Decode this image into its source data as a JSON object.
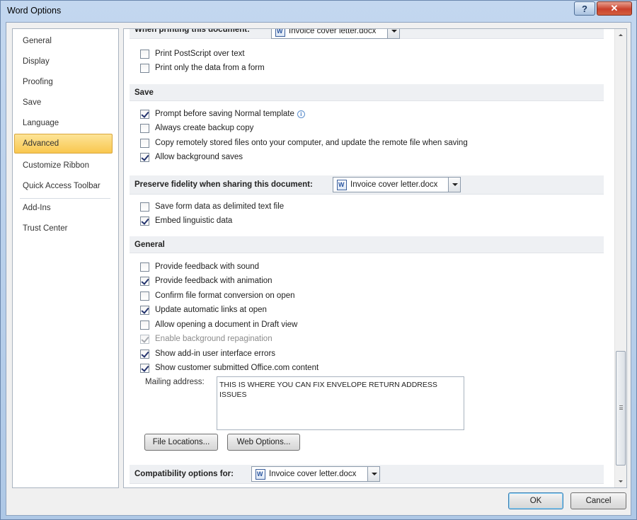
{
  "window": {
    "title": "Word Options",
    "help_glyph": "?",
    "close_glyph": "✕"
  },
  "nav": {
    "items": [
      {
        "label": "General"
      },
      {
        "label": "Display"
      },
      {
        "label": "Proofing"
      },
      {
        "label": "Save"
      },
      {
        "label": "Language"
      },
      {
        "label": "Advanced",
        "selected": true
      },
      {
        "label": "Customize Ribbon"
      },
      {
        "label": "Quick Access Toolbar"
      },
      {
        "label": "Add-Ins"
      },
      {
        "label": "Trust Center"
      }
    ]
  },
  "printing": {
    "header": "When printing this document:",
    "document": "Invoice cover letter.docx",
    "options": [
      {
        "label": "Print PostScript over text",
        "checked": false
      },
      {
        "label": "Print only the data from a form",
        "checked": false
      }
    ]
  },
  "save": {
    "header": "Save",
    "options": [
      {
        "label": "Prompt before saving Normal template",
        "checked": true
      },
      {
        "label": "Always create backup copy",
        "checked": false
      },
      {
        "label": "Copy remotely stored files onto your computer, and update the remote file when saving",
        "checked": false
      },
      {
        "label": "Allow background saves",
        "checked": true
      }
    ]
  },
  "fidelity": {
    "header": "Preserve fidelity when sharing this document:",
    "document": "Invoice cover letter.docx",
    "options": [
      {
        "label": "Save form data as delimited text file",
        "checked": false
      },
      {
        "label": "Embed linguistic data",
        "checked": true
      }
    ]
  },
  "general": {
    "header": "General",
    "options": [
      {
        "label": "Provide feedback with sound",
        "checked": false
      },
      {
        "label": "Provide feedback with animation",
        "checked": true
      },
      {
        "label": "Confirm file format conversion on open",
        "checked": false
      },
      {
        "label": "Update automatic links at open",
        "checked": true
      },
      {
        "label": "Allow opening a document in Draft view",
        "checked": false
      },
      {
        "label": "Enable background repagination",
        "checked": true,
        "disabled": true
      },
      {
        "label": "Show add-in user interface errors",
        "checked": true
      },
      {
        "label": "Show customer submitted Office.com content",
        "checked": true
      }
    ],
    "mailing_label": "Mailing address:",
    "mailing_value": "THIS IS WHERE YOU CAN FIX ENVELOPE RETURN ADDRESS ISSUES",
    "file_locations_button": "File Locations...",
    "web_options_button": "Web Options..."
  },
  "compatibility": {
    "header": "Compatibility options for:",
    "document": "Invoice cover letter.docx"
  },
  "buttons": {
    "ok": "OK",
    "cancel": "Cancel"
  }
}
